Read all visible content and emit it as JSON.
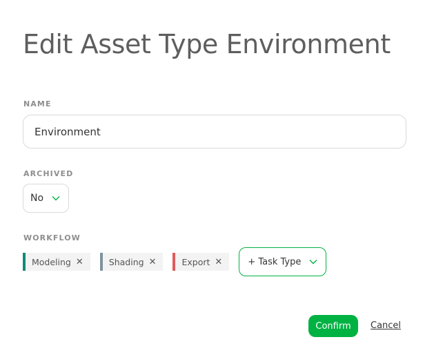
{
  "modal": {
    "title": "Edit Asset Type Environment"
  },
  "form": {
    "name_label": "NAME",
    "name_value": "Environment",
    "archived_label": "ARCHIVED",
    "archived_value": "No",
    "workflow_label": "WORKFLOW",
    "workflow_tags": [
      {
        "label": "Modeling",
        "color": "#0f8a7a"
      },
      {
        "label": "Shading",
        "color": "#7f939e"
      },
      {
        "label": "Export",
        "color": "#e05a5a"
      }
    ],
    "add_task_label": "+ Task Type"
  },
  "actions": {
    "confirm_label": "Confirm",
    "cancel_label": "Cancel"
  },
  "colors": {
    "accent": "#00b242",
    "title": "#5e5e5e",
    "label": "#8e8e8e"
  },
  "icons": {
    "dropdown": "chevron-down-icon",
    "remove": "close-icon"
  }
}
